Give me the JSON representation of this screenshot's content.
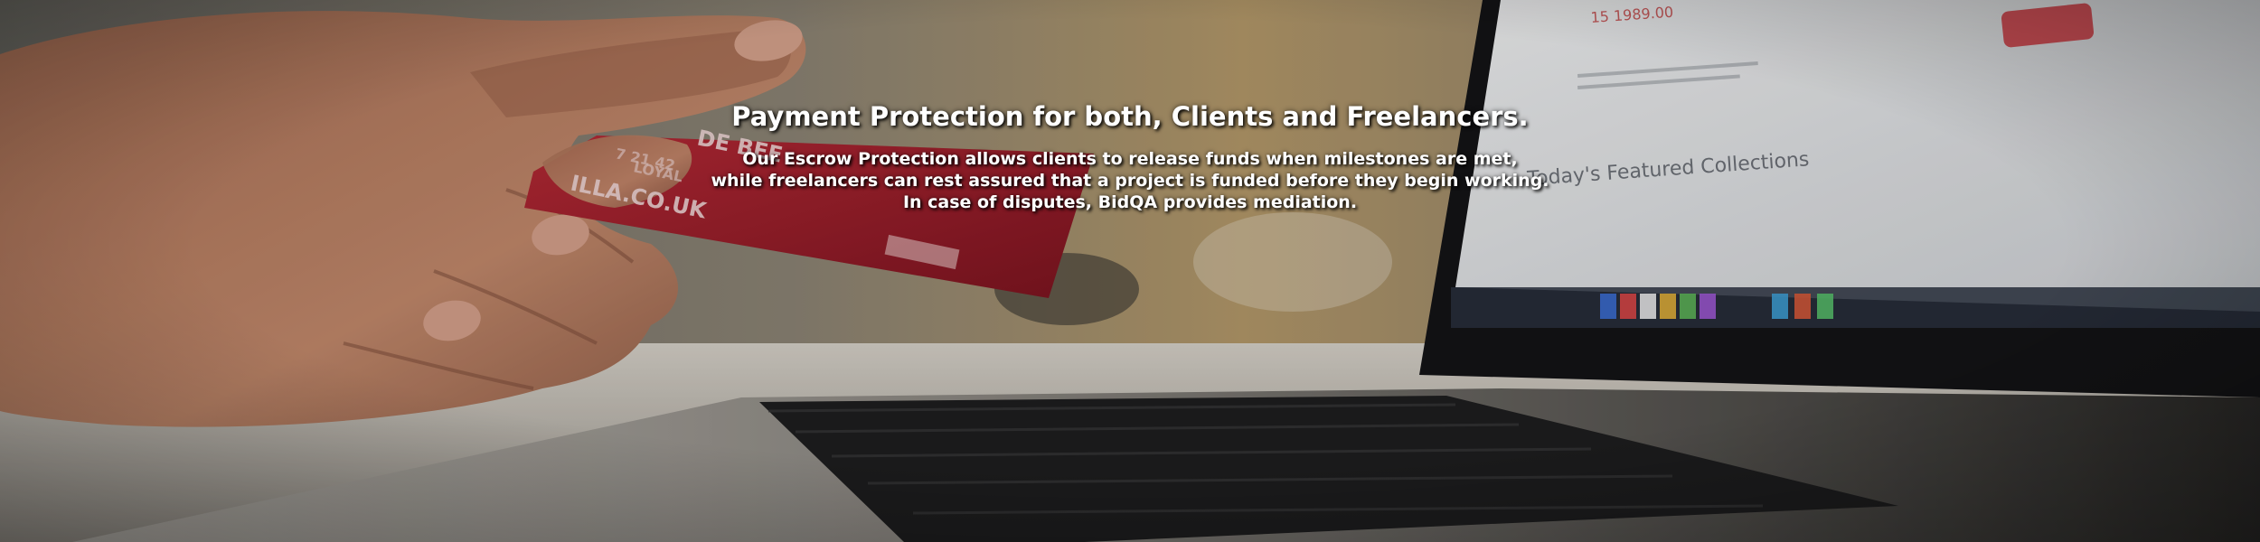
{
  "hero": {
    "title": "Payment Protection for both, Clients and Freelancers.",
    "description_lines": [
      "Our Escrow Protection allows clients to release funds when milestones are met,",
      "while freelancers can rest assured that a project is funded before they begin working.",
      "In case of disputes, BidQA provides mediation."
    ],
    "background": {
      "card_text": [
        "DE BEE",
        "LOYAL",
        "ILLA.CO.UK",
        "7 21 42"
      ],
      "screen_text": [
        "Today's Featured Collections",
        "15 1989.00"
      ]
    }
  },
  "colors": {
    "text": "#ffffff",
    "card_red": "#a8202c",
    "laptop_dark": "#1c1c1e",
    "screen_light": "#e9eaec"
  }
}
